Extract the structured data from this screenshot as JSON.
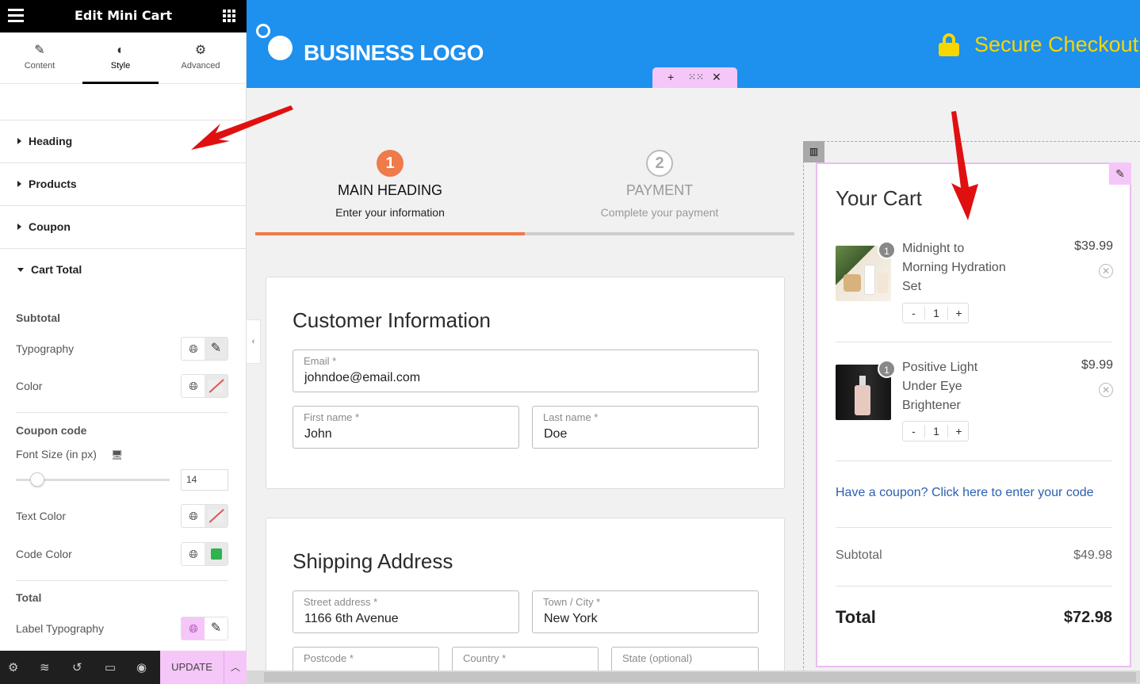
{
  "panel": {
    "title": "Edit Mini Cart",
    "tabs": [
      {
        "label": "Content",
        "icon": "pencil-icon",
        "active": false
      },
      {
        "label": "Style",
        "icon": "contrast-icon",
        "active": true
      },
      {
        "label": "Advanced",
        "icon": "gear-icon",
        "active": false
      }
    ],
    "sections": [
      {
        "label": "Heading",
        "expanded": false
      },
      {
        "label": "Products",
        "expanded": false
      },
      {
        "label": "Coupon",
        "expanded": false
      },
      {
        "label": "Cart Total",
        "expanded": true
      }
    ],
    "subtotal": {
      "heading": "Subtotal",
      "typography_label": "Typography",
      "color_label": "Color"
    },
    "coupon_code": {
      "heading": "Coupon code",
      "font_size_label": "Font Size (in px)",
      "font_size_value": "14",
      "font_size_fraction": 0.14,
      "text_color_label": "Text Color",
      "code_color_label": "Code Color",
      "code_color": "#2fb24f"
    },
    "total": {
      "heading": "Total",
      "label_typography": "Label Typography"
    },
    "footer": {
      "update_label": "UPDATE"
    }
  },
  "header": {
    "logo_text": "BUSINESS LOGO",
    "secure_text": "Secure Checkout",
    "bg_color": "#1e90ee",
    "accent": "#f7d600"
  },
  "steps": [
    {
      "number": "1",
      "title": "MAIN HEADING",
      "desc": "Enter your information",
      "active": true
    },
    {
      "number": "2",
      "title": "PAYMENT",
      "desc": "Complete your payment",
      "active": false
    }
  ],
  "customer": {
    "title": "Customer Information",
    "email": {
      "label": "Email *",
      "value": "johndoe@email.com"
    },
    "first_name": {
      "label": "First name *",
      "value": "John"
    },
    "last_name": {
      "label": "Last name *",
      "value": "Doe"
    }
  },
  "shipping": {
    "title": "Shipping Address",
    "street": {
      "label": "Street address *",
      "value": "1166 6th Avenue"
    },
    "town": {
      "label": "Town / City *",
      "value": "New York"
    },
    "postcode": {
      "label": "Postcode *"
    },
    "country": {
      "label": "Country *"
    },
    "state": {
      "label": "State (optional)"
    }
  },
  "cart": {
    "title": "Your Cart",
    "items": [
      {
        "name": "Midnight to Morning Hydration Set",
        "price": "$39.99",
        "qty": "1",
        "badge": "1",
        "minus": "-",
        "plus": "+"
      },
      {
        "name": "Positive Light Under Eye Brightener",
        "price": "$9.99",
        "qty": "1",
        "badge": "1",
        "minus": "-",
        "plus": "+"
      }
    ],
    "coupon_link": "Have a coupon? Click here to enter your code",
    "subtotal_label": "Subtotal",
    "subtotal_value": "$49.98",
    "total_label": "Total",
    "total_value": "$72.98"
  }
}
